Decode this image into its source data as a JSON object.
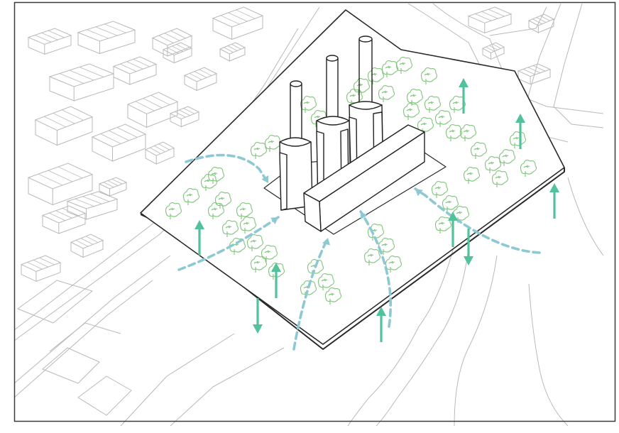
{
  "diagram": {
    "colors": {
      "background": "#ffffff",
      "frame": "#3a3a3a",
      "context_lines": "#b9b9b9",
      "site_outline": "#2a2a2a",
      "building": "#222222",
      "tree": "#7fc47a",
      "vertical_arrow": "#52c29a",
      "airflow": "#8ec9d3"
    },
    "icons": {
      "vertical_flow": "arrow-icon",
      "horizontal_flow": "dashed-arrow-icon",
      "vegetation": "tree-icon"
    },
    "chimney_count": 3
  }
}
